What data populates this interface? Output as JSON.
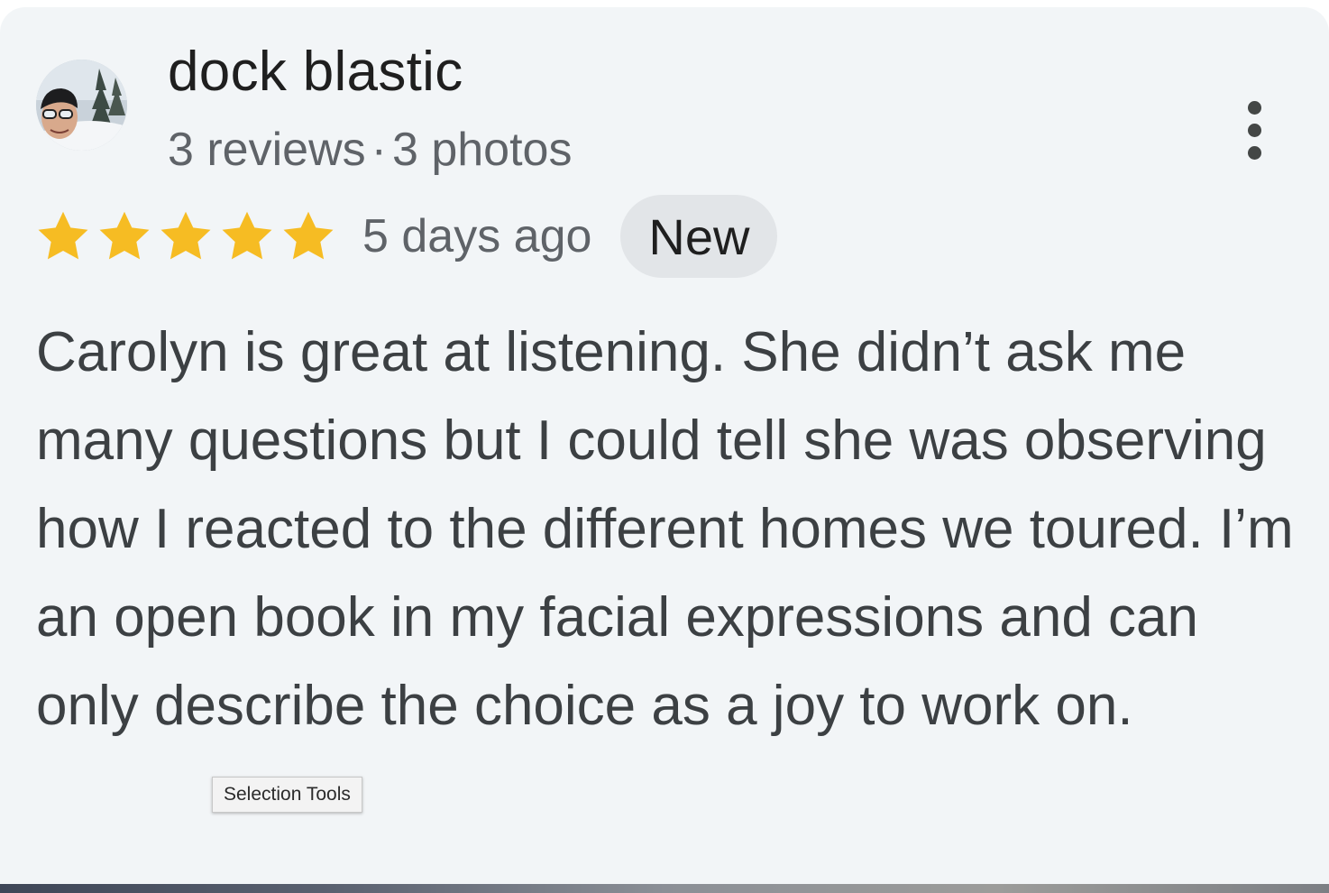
{
  "review": {
    "reviewer_name": "dock blastic",
    "review_count": "3 reviews",
    "separator": "·",
    "photo_count": "3 photos",
    "rating": 5,
    "rating_max": 5,
    "star_color": "#f6bc23",
    "date": "5 days ago",
    "badge": "New",
    "text": "Carolyn is great at listening. She didn’t ask me many questions but I could tell she was observing how I reacted to the different homes we toured. I’m an open book in my facial expressions and can only describe the choice as a joy to work on."
  },
  "icons": {
    "avatar": "reviewer-avatar-photo",
    "menu": "more-vert-icon",
    "star": "star-icon"
  },
  "tooltip": {
    "label": "Selection Tools"
  }
}
